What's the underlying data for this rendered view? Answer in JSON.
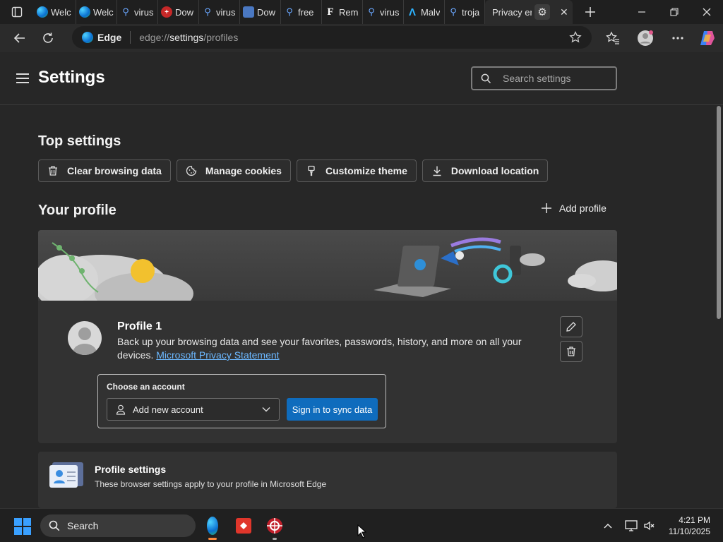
{
  "tabs": [
    {
      "icon": "edge-icon",
      "label": "Welc"
    },
    {
      "icon": "edge-icon",
      "label": "Welc"
    },
    {
      "icon": "search-icon",
      "label": "virus"
    },
    {
      "icon": "red-shield-icon",
      "label": "Dow"
    },
    {
      "icon": "search-icon",
      "label": "virus"
    },
    {
      "icon": "document-icon",
      "label": "Dow"
    },
    {
      "icon": "search-icon",
      "label": "free"
    },
    {
      "icon": "f-letter-icon",
      "label": "Rem"
    },
    {
      "icon": "search-icon",
      "label": "virus"
    },
    {
      "icon": "a-logo-icon",
      "label": "Malv"
    },
    {
      "icon": "search-icon",
      "label": "troja"
    },
    {
      "icon": "settings-icon",
      "label": "Privacy er",
      "active": true
    }
  ],
  "address_bar": {
    "browser_label": "Edge",
    "url_prefix": "edge://",
    "url_host": "settings",
    "url_path": "/profiles"
  },
  "settings": {
    "title": "Settings",
    "search_placeholder": "Search settings",
    "top_settings_title": "Top settings",
    "quick_actions": [
      {
        "icon": "trash-icon",
        "label": "Clear browsing data"
      },
      {
        "icon": "cookie-icon",
        "label": "Manage cookies"
      },
      {
        "icon": "brush-icon",
        "label": "Customize theme"
      },
      {
        "icon": "download-icon",
        "label": "Download location"
      }
    ],
    "your_profile_title": "Your profile",
    "add_profile_label": "Add profile",
    "profile": {
      "name": "Profile 1",
      "description": "Back up your browsing data and see your favorites, passwords, history, and more on all your devices.",
      "privacy_link": "Microsoft Privacy Statement",
      "choose_account_label": "Choose an account",
      "account_select_value": "Add new account",
      "sync_button_label": "Sign in to sync data"
    },
    "profile_settings": {
      "title": "Profile settings",
      "description": "These browser settings apply to your profile in Microsoft Edge"
    }
  },
  "taskbar": {
    "search_label": "Search",
    "time": "4:21 PM",
    "date": "11/10/2025"
  },
  "colors": {
    "accent": "#0f6cbd",
    "link": "#6cb8ff",
    "page_bg": "#272727",
    "card_bg": "#323232"
  }
}
